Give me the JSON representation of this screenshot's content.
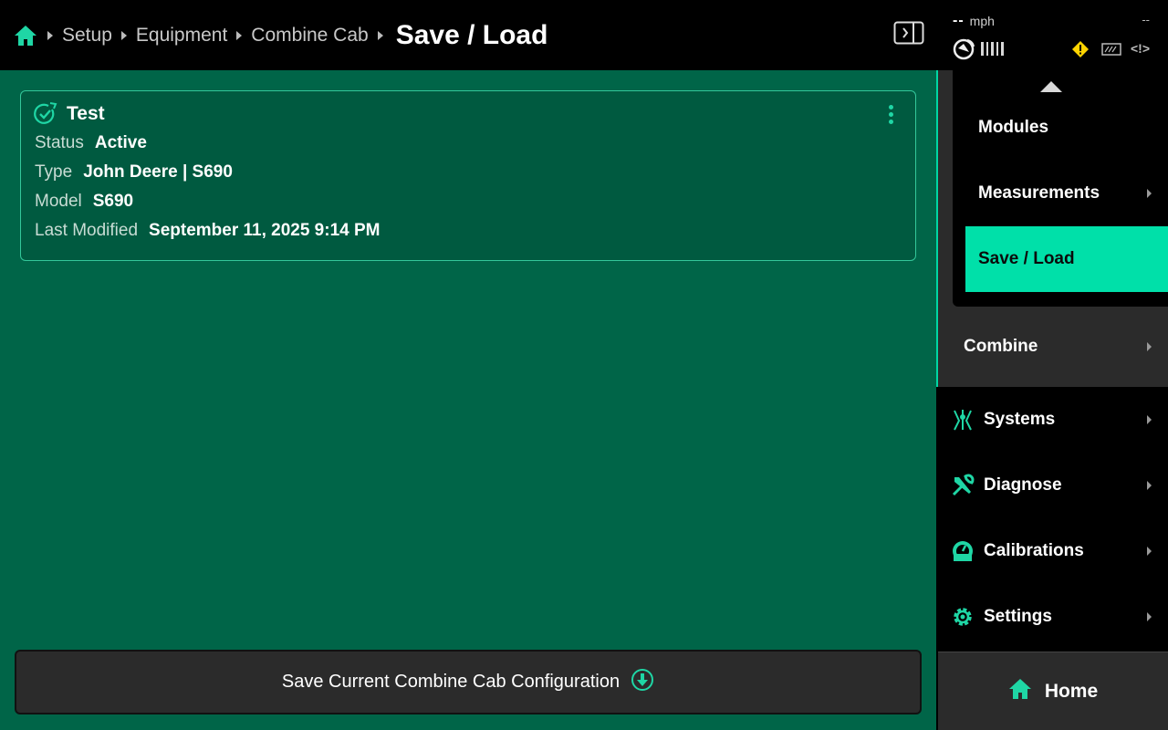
{
  "header": {
    "breadcrumb": [
      "Setup",
      "Equipment",
      "Combine Cab"
    ],
    "current": "Save / Load"
  },
  "status": {
    "speed_value": "--",
    "speed_unit": "mph",
    "right_value": "--",
    "icons": [
      "gps-icon",
      "signal-bars-icon",
      "warning-icon",
      "implement-icon",
      "alert-code-icon"
    ]
  },
  "card": {
    "title": "Test",
    "fields": [
      {
        "label": "Status",
        "value": "Active"
      },
      {
        "label": "Type",
        "value": "John Deere | S690"
      },
      {
        "label": "Model",
        "value": "S690"
      },
      {
        "label": "Last Modified",
        "value": "September 11, 2025 9:14 PM"
      }
    ]
  },
  "save_button": {
    "label": "Save Current Combine Cab Configuration"
  },
  "sidebar": {
    "sub_items": [
      "Modules",
      "Measurements",
      "Save / Load"
    ],
    "active_sub": "Save / Load",
    "parent": "Combine",
    "items": [
      "Systems",
      "Diagnose",
      "Calibrations",
      "Settings"
    ],
    "home": "Home"
  },
  "colors": {
    "accent": "#00e0a9",
    "main_bg": "#006548",
    "card_bg": "#005a40",
    "card_border": "#33c79a",
    "warning": "#ffd400"
  }
}
